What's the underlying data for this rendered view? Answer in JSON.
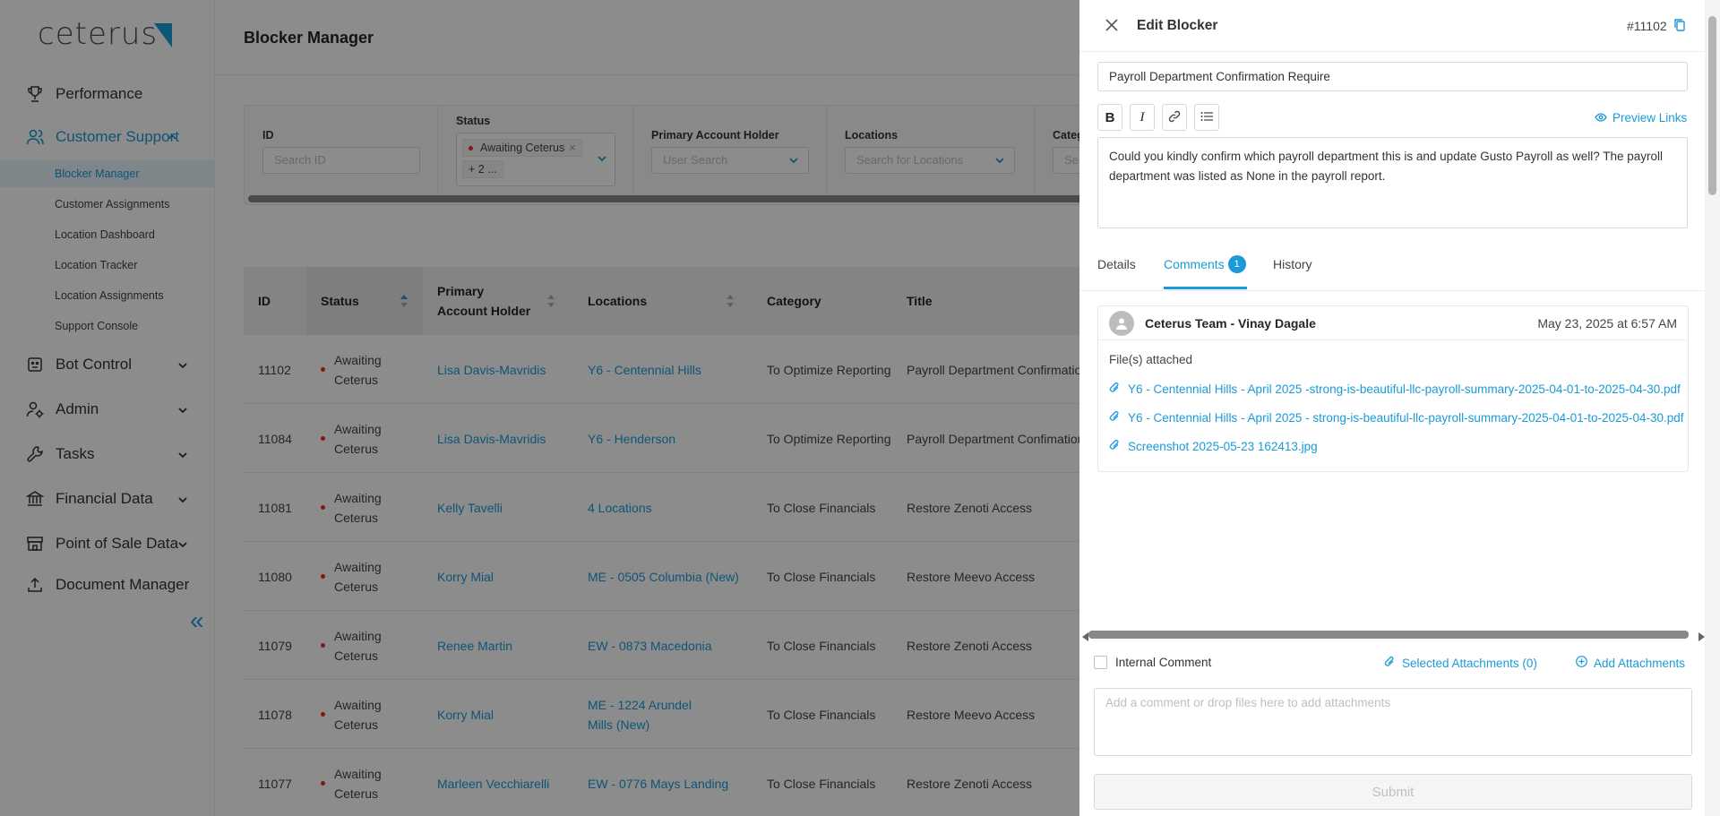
{
  "sidebar": {
    "logo": "ceterus",
    "nav": [
      {
        "label": "Performance",
        "icon": "trophy-icon"
      },
      {
        "label": "Customer Support",
        "icon": "users-icon"
      },
      {
        "label": "Bot Control",
        "icon": "bot-icon"
      },
      {
        "label": "Admin",
        "icon": "admin-icon"
      },
      {
        "label": "Tasks",
        "icon": "wrench-icon"
      },
      {
        "label": "Financial Data",
        "icon": "bank-icon"
      },
      {
        "label": "Point of Sale Data",
        "icon": "store-icon"
      },
      {
        "label": "Document Manager",
        "icon": "upload-icon"
      }
    ],
    "sub_items": [
      "Blocker Manager",
      "Customer Assignments",
      "Location Dashboard",
      "Location Tracker",
      "Location Assignments",
      "Support Console"
    ],
    "collapse_icon": "«"
  },
  "main": {
    "page_title": "Blocker Manager",
    "filters": {
      "id": {
        "label": "ID",
        "placeholder": "Search ID"
      },
      "status": {
        "label": "Status",
        "tag": "Awaiting Ceterus",
        "more": "+ 2 ..."
      },
      "holder": {
        "label": "Primary Account Holder",
        "placeholder": "User Search"
      },
      "locations": {
        "label": "Locations",
        "placeholder": "Search for Locations"
      },
      "category": {
        "label": "Categ",
        "placeholder": "Se"
      }
    },
    "table": {
      "headers": [
        "ID",
        "Status",
        "Primary Account Holder",
        "Locations",
        "Category",
        "Title"
      ],
      "rows": [
        {
          "id": "11102",
          "status": "Awaiting Ceterus",
          "holder": "Lisa Davis-Mavridis",
          "location": "Y6 - Centennial Hills",
          "category": "To Optimize Reporting",
          "title": "Payroll Department Confirmatio"
        },
        {
          "id": "11084",
          "status": "Awaiting Ceterus",
          "holder": "Lisa Davis-Mavridis",
          "location": "Y6 - Henderson",
          "category": "To Optimize Reporting",
          "title": "Payroll Department Confimation"
        },
        {
          "id": "11081",
          "status": "Awaiting Ceterus",
          "holder": "Kelly Tavelli",
          "location": "4 Locations",
          "category": "To Close Financials",
          "title": "Restore Zenoti Access"
        },
        {
          "id": "11080",
          "status": "Awaiting Ceterus",
          "holder": "Korry Mial",
          "location": "ME - 0505 Columbia (New)",
          "category": "To Close Financials",
          "title": "Restore Meevo Access"
        },
        {
          "id": "11079",
          "status": "Awaiting Ceterus",
          "holder": "Renee Martin",
          "location": "EW - 0873 Macedonia",
          "category": "To Close Financials",
          "title": "Restore Zenoti Access"
        },
        {
          "id": "11078",
          "status": "Awaiting Ceterus",
          "holder": "Korry Mial",
          "location": "ME - 1224 Arundel Mills (New)",
          "category": "To Close Financials",
          "title": "Restore Meevo Access"
        },
        {
          "id": "11077",
          "status": "Awaiting Ceterus",
          "holder": "Marleen Vecchiarelli",
          "location": "EW - 0776 Mays Landing",
          "category": "To Close Financials",
          "title": "Restore Zenoti Access"
        }
      ]
    }
  },
  "drawer": {
    "title": "Edit Blocker",
    "blocker_id": "#11102",
    "title_value": "Payroll Department Confirmation Require",
    "preview_links": "Preview Links",
    "description": "Could you kindly confirm which payroll department this is and update Gusto Payroll as well? The payroll department was listed as None in the payroll report.",
    "tabs": {
      "details": "Details",
      "comments": "Comments",
      "comments_count": "1",
      "history": "History"
    },
    "comment": {
      "author": "Ceterus Team - Vinay Dagale",
      "date": "May 23, 2025 at 6:57 AM",
      "files_label": "File(s) attached",
      "attachments": [
        "Y6 - Centennial Hills - April 2025 -strong-is-beautiful-llc-payroll-summary-2025-04-01-to-2025-04-30.pdf",
        "Y6 - Centennial Hills - April 2025 - strong-is-beautiful-llc-payroll-summary-2025-04-01-to-2025-04-30.pdf",
        "Screenshot 2025-05-23 162413.jpg"
      ]
    },
    "footer": {
      "internal_comment": "Internal Comment",
      "selected_attachments": "Selected Attachments (0)",
      "add_attachments": "Add Attachments",
      "comment_placeholder": "Add a comment or drop files here to add attachments",
      "submit": "Submit"
    }
  },
  "colors": {
    "accent": "#1a9bd7",
    "status_dot": "#e5322d",
    "overlay": "rgba(0,0,0,0.45)"
  }
}
